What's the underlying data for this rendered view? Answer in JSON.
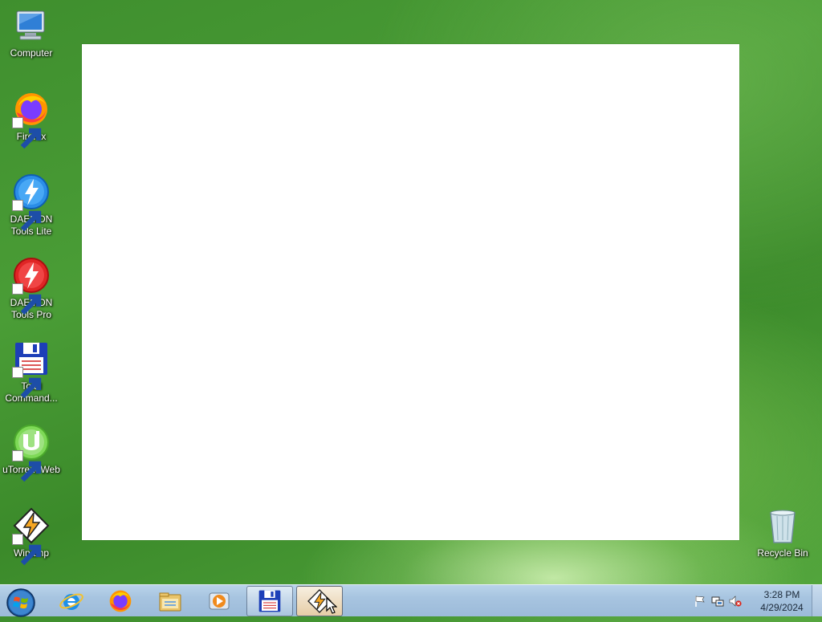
{
  "desktop": {
    "icons": [
      {
        "label": "Computer",
        "icon": "computer-icon"
      },
      {
        "label": "Firefox",
        "icon": "firefox-icon"
      },
      {
        "label": "DAEMON Tools Lite",
        "icon": "daemon-tools-lite-icon"
      },
      {
        "label": "DAEMON Tools Pro",
        "icon": "daemon-tools-pro-icon"
      },
      {
        "label": "Total Command...",
        "icon": "total-commander-icon"
      },
      {
        "label": "uTorrent Web",
        "icon": "utorrent-icon"
      },
      {
        "label": "Winamp",
        "icon": "winamp-icon"
      },
      {
        "label": "Recycle Bin",
        "icon": "recycle-bin-icon"
      }
    ]
  },
  "taskbar": {
    "start": "start-orb-icon",
    "pinned": [
      "internet-explorer-icon",
      "firefox-icon",
      "file-explorer-icon",
      "media-player-icon"
    ],
    "open": [
      "total-commander-icon",
      "winamp-icon"
    ],
    "active": "winamp-icon",
    "tray": [
      "action-center-flag-icon",
      "network-icon",
      "volume-muted-icon"
    ],
    "clock": {
      "time": "3:28 PM",
      "date": "4/29/2024"
    }
  },
  "colors": {
    "desktop_green": "#4a9d36",
    "taskbar_blue": "#a7c4e0",
    "window_bg": "#ffffff"
  }
}
